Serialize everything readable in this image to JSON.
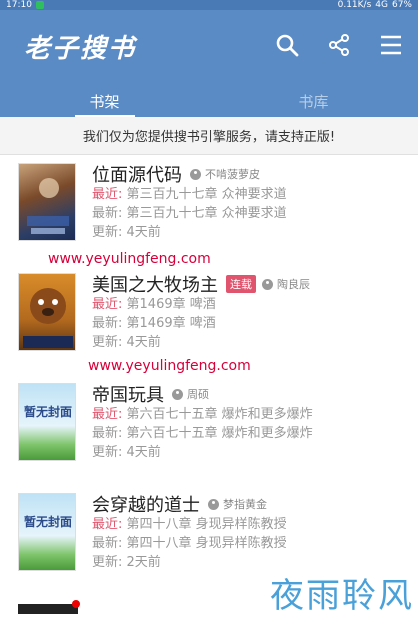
{
  "status": {
    "time": "17:10",
    "network": "0.11K/s",
    "signal": "4G",
    "battery": "67%"
  },
  "appbar": {
    "title": "老子搜书",
    "colors": {
      "bar": "#5a8bc5"
    }
  },
  "tabs": [
    {
      "label": "书架"
    },
    {
      "label": "书库"
    }
  ],
  "notice": "我们仅为您提供搜书引擎服务，请支持正版!",
  "labels": {
    "latest": "最近:",
    "newest": "最新:",
    "updated": "更新:"
  },
  "books": [
    {
      "title": "位面源代码",
      "author": "不啃菠萝皮",
      "tag": "",
      "latest": "第三百九十七章 众神要求道",
      "newest": "第三百九十七章 众神要求道",
      "updated": "4天前"
    },
    {
      "title": "美国之大牧场主",
      "author": "陶良辰",
      "tag": "连载",
      "latest": "第1469章 啤酒",
      "newest": "第1469章 啤酒",
      "updated": "4天前"
    },
    {
      "title": "帝国玩具",
      "author": "周硕",
      "tag": "",
      "latest": "第六百七十五章 爆炸和更多爆炸",
      "newest": "第六百七十五章 爆炸和更多爆炸",
      "updated": "4天前"
    },
    {
      "title": "会穿越的道士",
      "author": "梦指黄金",
      "tag": "",
      "latest": "第四十八章 身现异样陈教授",
      "newest": "第四十八章 身现异样陈教授",
      "updated": "2天前"
    }
  ],
  "placeholder_cover": "暂无封面",
  "watermarks": [
    "www.yeyulingfeng.com",
    "www.yeyulingfeng.com"
  ],
  "brand": "夜雨聆风"
}
